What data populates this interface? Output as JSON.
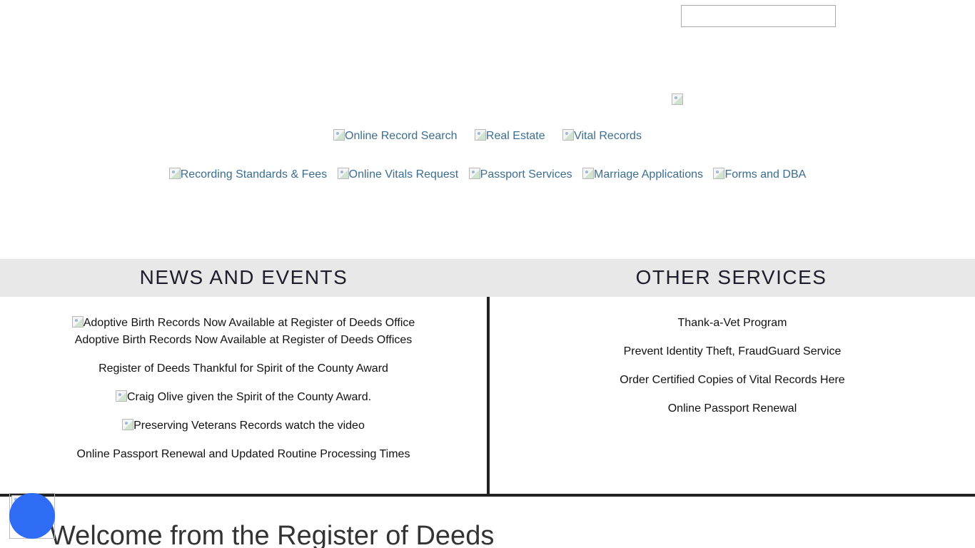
{
  "search": {
    "value": "",
    "placeholder": ""
  },
  "nav": {
    "row1": [
      {
        "label": "Online Record Search",
        "icon": "broken-image-icon"
      },
      {
        "label": "Real Estate",
        "icon": "broken-image-icon"
      },
      {
        "label": "Vital Records",
        "icon": "broken-image-icon"
      }
    ],
    "row2": [
      {
        "label": "Recording Standards & Fees",
        "icon": "broken-image-icon"
      },
      {
        "label": "Online Vitals Request",
        "icon": "broken-image-icon"
      },
      {
        "label": "Passport Services",
        "icon": "broken-image-icon"
      },
      {
        "label": "Marriage Applications",
        "icon": "broken-image-icon"
      },
      {
        "label": "Forms and DBA",
        "icon": "broken-image-icon"
      }
    ]
  },
  "sections": {
    "news": {
      "title": "NEWS AND EVENTS",
      "items": [
        {
          "image_alt": "Adoptive Birth Records Now Available at Register of Deeds Office",
          "text": "Adoptive Birth Records Now Available at Register of Deeds Offices"
        },
        {
          "text": "Register of Deeds Thankful for Spirit of the County Award"
        },
        {
          "image_alt": "Craig Olive given the Spirit of the County Award."
        },
        {
          "image_alt": "Preserving Veterans Records watch the video"
        },
        {
          "text": "Online Passport Renewal and Updated Routine Processing Times"
        }
      ]
    },
    "other": {
      "title": "OTHER SERVICES",
      "items": [
        {
          "text": "Thank-a-Vet Program"
        },
        {
          "text": "Prevent Identity Theft, FraudGuard Service"
        },
        {
          "text": "Order Certified Copies of Vital Records Here"
        },
        {
          "text": "Online Passport Renewal"
        }
      ]
    }
  },
  "welcome": {
    "title": "Welcome from the Register of Deeds"
  },
  "colors": {
    "nav_link": "#3b6e8f",
    "section_bar": "#e8e8e8",
    "divider": "#222222",
    "widget": "#2e6cf6"
  }
}
